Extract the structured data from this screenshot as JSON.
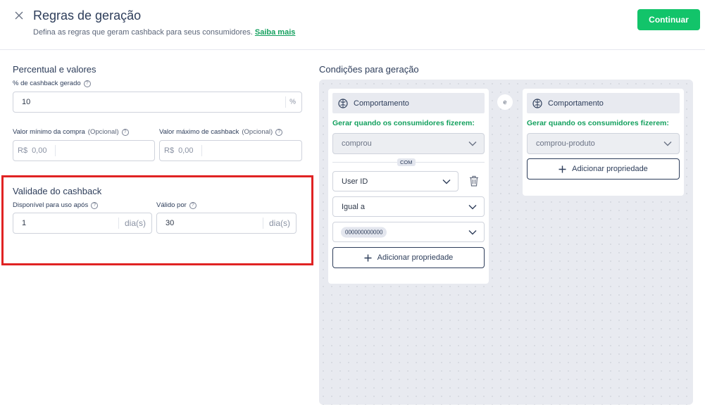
{
  "header": {
    "title": "Regras de geração",
    "subtitle": "Defina as regras que geram cashback para seus consumidores.",
    "learn_more": "Saiba mais",
    "continue_label": "Continuar"
  },
  "percent_section": {
    "title": "Percentual e valores",
    "cashback_label": "% de cashback gerado",
    "cashback_value": "10",
    "cashback_suffix": "%",
    "min_purchase_label": "Valor mínimo da compra",
    "max_cashback_label": "Valor máximo de cashback",
    "optional": "(Opcional)",
    "currency": "R$",
    "min_placeholder": "0,00",
    "max_placeholder": "0,00"
  },
  "validity_section": {
    "title": "Validade do cashback",
    "available_label": "Disponível para uso após",
    "available_value": "1",
    "valid_label": "Válido por",
    "valid_value": "30",
    "unit": "dia(s)"
  },
  "conditions": {
    "title": "Condições para geração",
    "connector": "e",
    "card1": {
      "head": "Comportamento",
      "sub": "Gerar quando os consumidores fizerem:",
      "action": "comprou",
      "com": "COM",
      "property": "User ID",
      "operator": "Igual a",
      "value_chip": "000000000000",
      "add_label": "Adicionar propriedade"
    },
    "card2": {
      "head": "Comportamento",
      "sub": "Gerar quando os consumidores fizerem:",
      "action": "comprou-produto",
      "add_label": "Adicionar propriedade"
    }
  },
  "colors": {
    "accent": "#12c46a",
    "highlight": "#e02323"
  }
}
